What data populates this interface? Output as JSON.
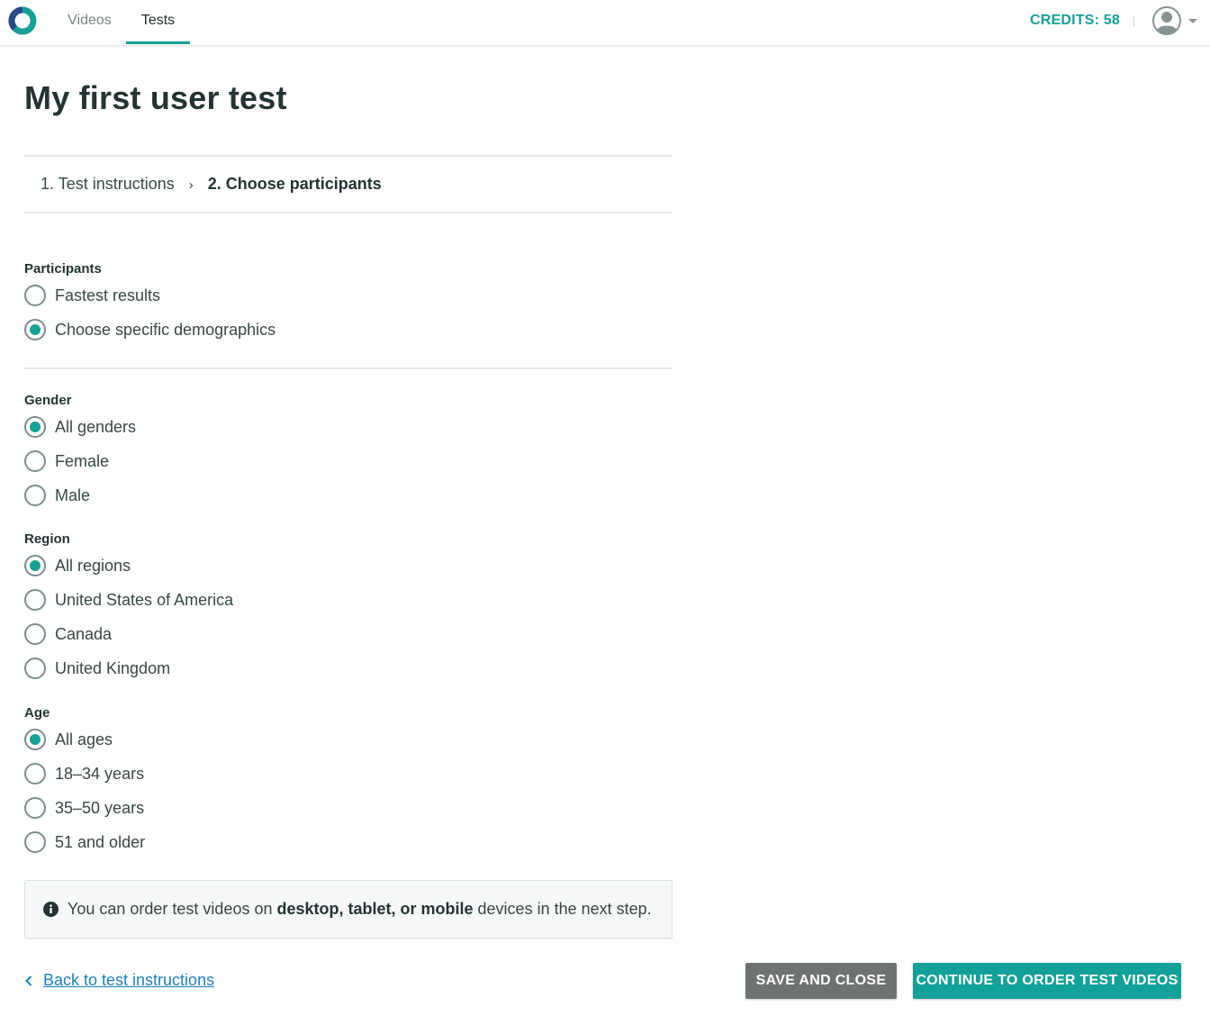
{
  "nav": {
    "tabs": [
      {
        "label": "Videos",
        "active": false
      },
      {
        "label": "Tests",
        "active": true
      }
    ],
    "credits": "CREDITS: 58",
    "accent_color": "#16a196"
  },
  "page": {
    "title": "My first user test"
  },
  "steps": {
    "step1": "1. Test instructions",
    "separator": "›",
    "step2": "2. Choose participants"
  },
  "participants": {
    "label": "Participants",
    "options": [
      {
        "label": "Fastest results",
        "checked": false
      },
      {
        "label": "Choose specific demographics",
        "checked": true
      }
    ]
  },
  "gender": {
    "label": "Gender",
    "options": [
      {
        "label": "All genders",
        "checked": true
      },
      {
        "label": "Female",
        "checked": false
      },
      {
        "label": "Male",
        "checked": false
      }
    ]
  },
  "region": {
    "label": "Region",
    "options": [
      {
        "label": "All regions",
        "checked": true
      },
      {
        "label": "United States of America",
        "checked": false
      },
      {
        "label": "Canada",
        "checked": false
      },
      {
        "label": "United Kingdom",
        "checked": false
      }
    ]
  },
  "age": {
    "label": "Age",
    "options": [
      {
        "label": "All ages",
        "checked": true
      },
      {
        "label": "18–34 years",
        "checked": false
      },
      {
        "label": "35–50 years",
        "checked": false
      },
      {
        "label": "51 and older",
        "checked": false
      }
    ]
  },
  "info": {
    "prefix": "You can order test videos on ",
    "bold": "desktop, tablet, or mobile",
    "suffix": " devices in the next step.",
    "icon": "info-icon"
  },
  "footer": {
    "back_label": "Back to test instructions",
    "save_label": "SAVE AND CLOSE",
    "continue_label": "CONTINUE TO ORDER TEST VIDEOS"
  }
}
